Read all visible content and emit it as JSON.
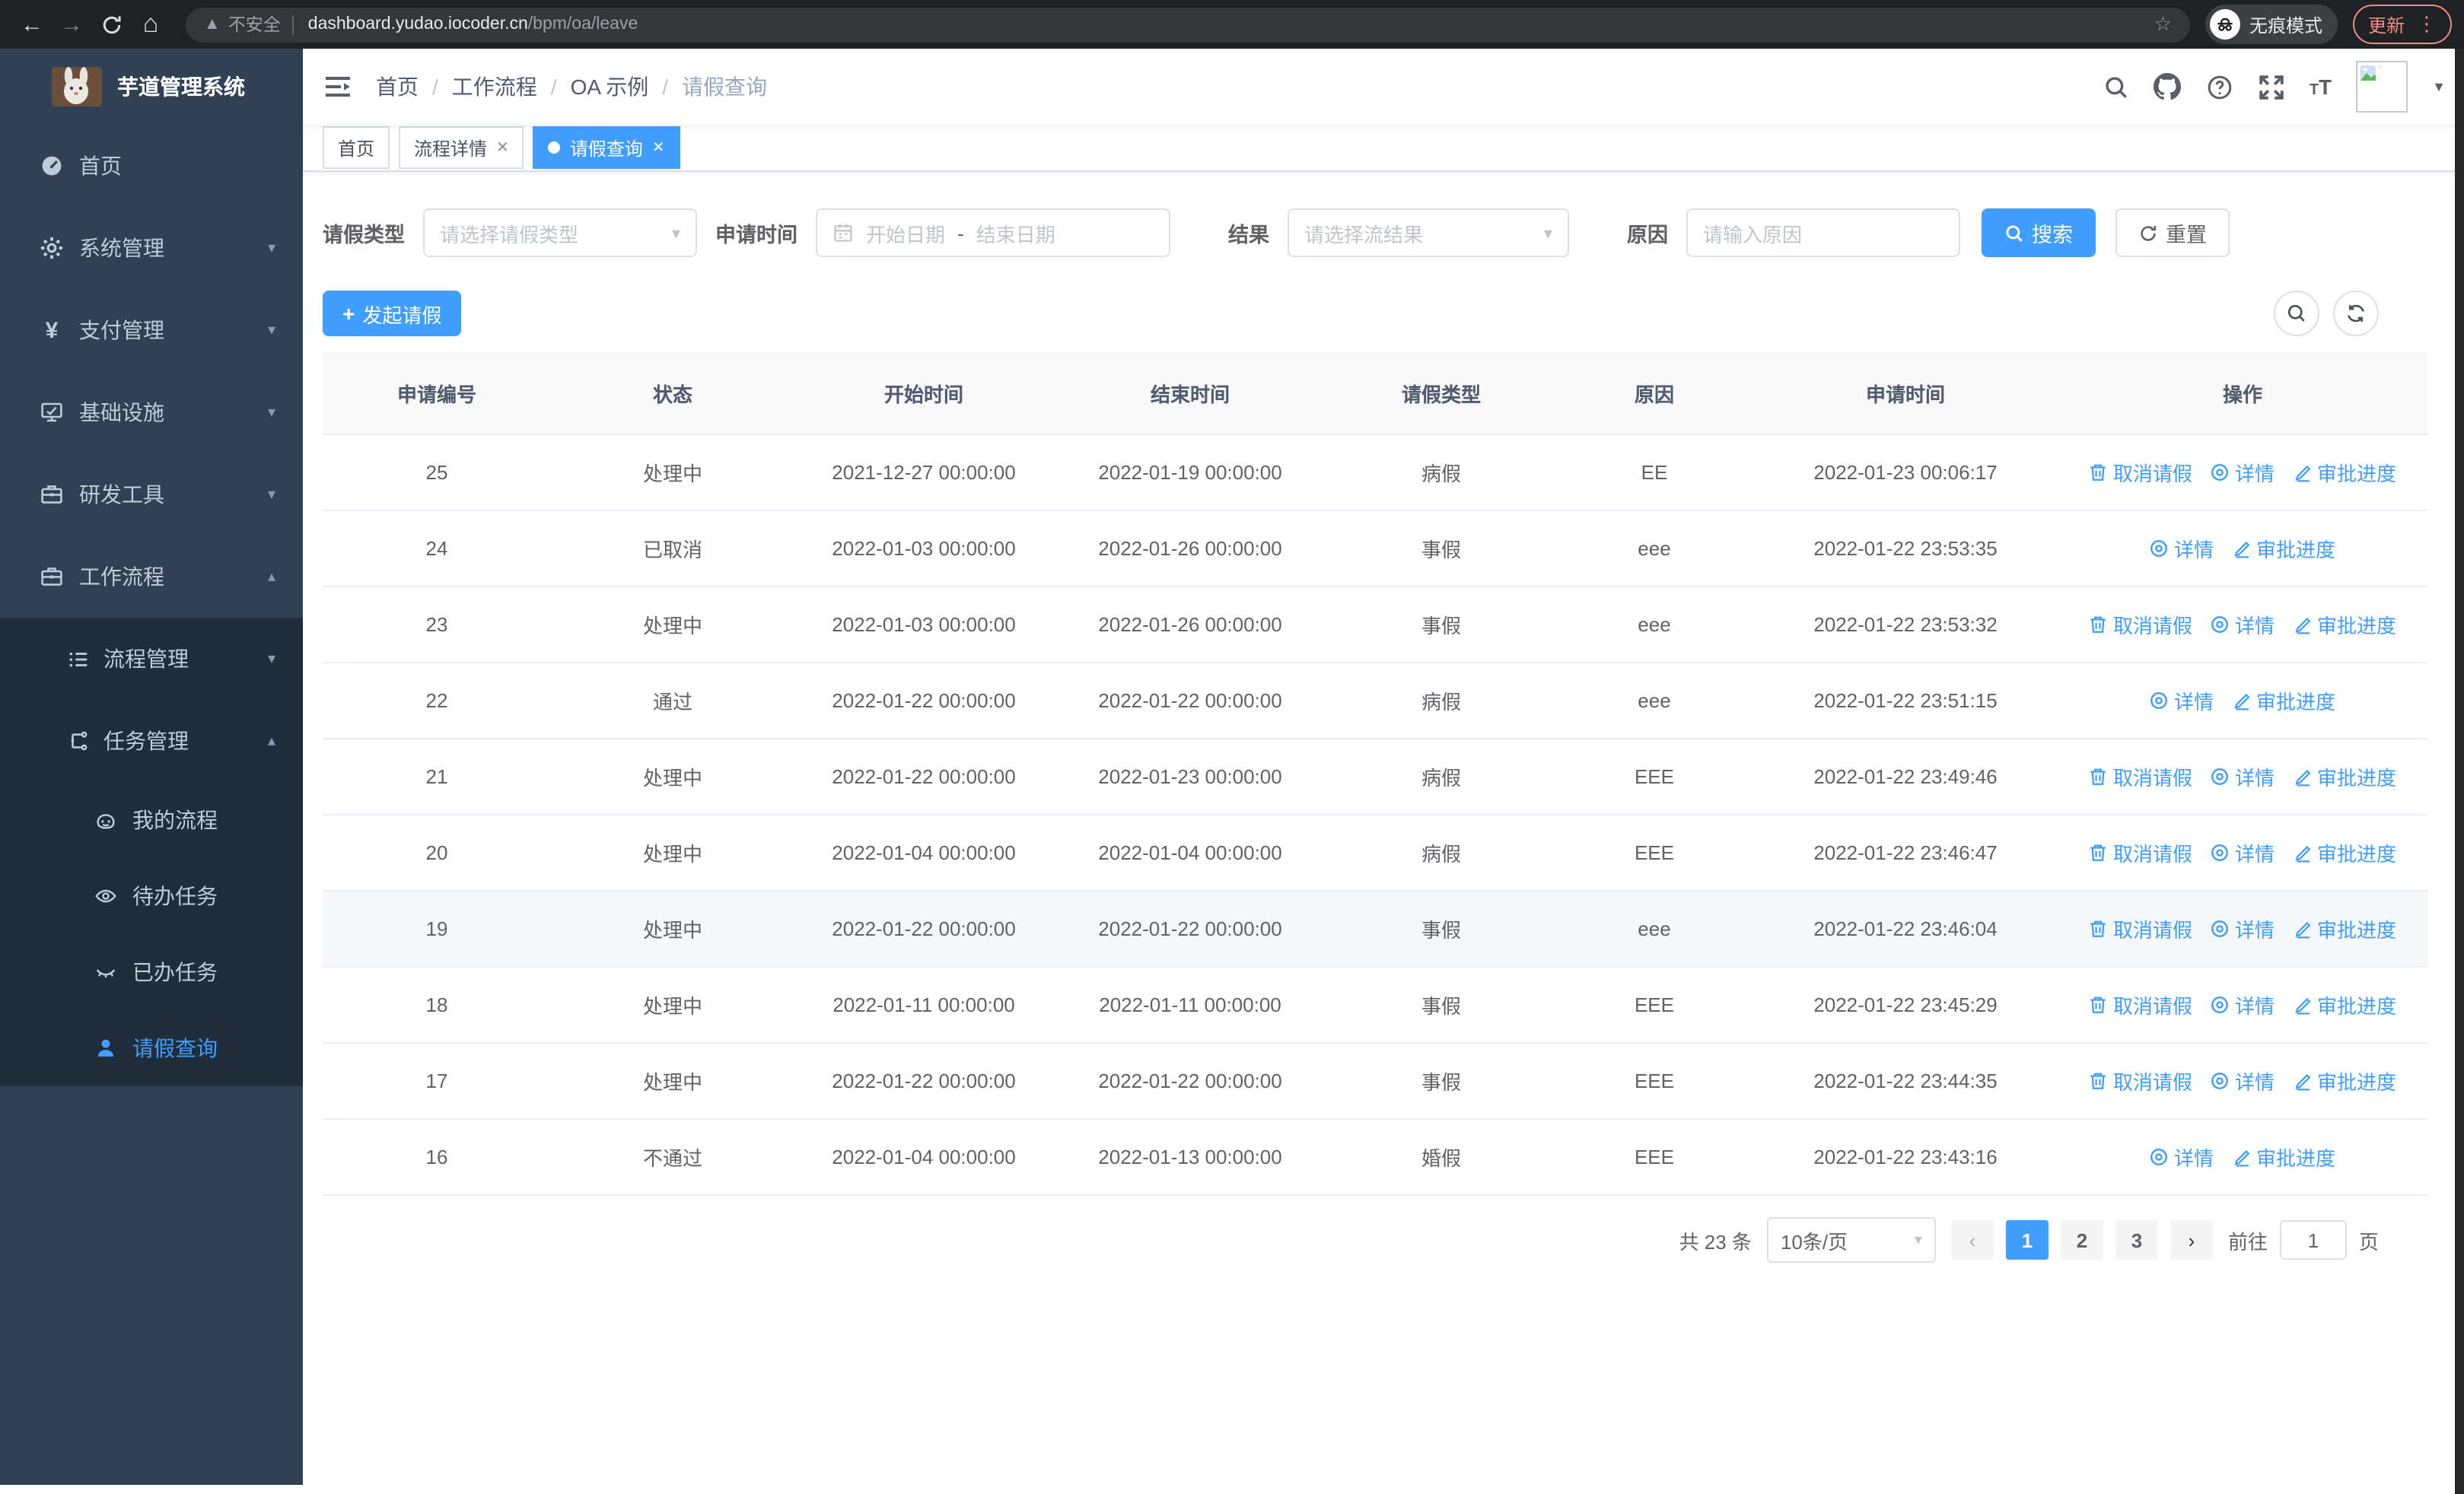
{
  "browser": {
    "security_label": "不安全",
    "url_host": "dashboard.yudao.iocoder.cn",
    "url_path": "/bpm/oa/leave",
    "incognito_label": "无痕模式",
    "update_label": "更新"
  },
  "sidebar": {
    "title": "芋道管理系统",
    "menu": [
      {
        "label": "首页",
        "icon": "dashboard-icon",
        "chevron": ""
      },
      {
        "label": "系统管理",
        "icon": "gear-icon",
        "chevron": "down"
      },
      {
        "label": "支付管理",
        "icon": "yen-icon",
        "chevron": "down"
      },
      {
        "label": "基础设施",
        "icon": "monitor-icon",
        "chevron": "down"
      },
      {
        "label": "研发工具",
        "icon": "toolbox-icon",
        "chevron": "down"
      },
      {
        "label": "工作流程",
        "icon": "workflow-icon",
        "chevron": "up"
      }
    ],
    "submenu": [
      {
        "label": "流程管理",
        "icon": "process-list-icon",
        "chevron": "down",
        "level": 2,
        "active": false
      },
      {
        "label": "任务管理",
        "icon": "task-tree-icon",
        "chevron": "up",
        "level": 2,
        "active": false
      },
      {
        "label": "我的流程",
        "icon": "robot-icon",
        "chevron": "",
        "level": 3,
        "active": false
      },
      {
        "label": "待办任务",
        "icon": "eye-icon",
        "chevron": "",
        "level": 3,
        "active": false
      },
      {
        "label": "已办任务",
        "icon": "eye-closed-icon",
        "chevron": "",
        "level": 3,
        "active": false
      },
      {
        "label": "请假查询",
        "icon": "user-icon",
        "chevron": "",
        "level": 3,
        "active": true
      }
    ]
  },
  "navbar": {
    "breadcrumb": [
      "首页",
      "工作流程",
      "OA 示例",
      "请假查询"
    ]
  },
  "tabs": [
    {
      "label": "首页",
      "closable": false,
      "active": false
    },
    {
      "label": "流程详情",
      "closable": true,
      "active": false
    },
    {
      "label": "请假查询",
      "closable": true,
      "active": true
    }
  ],
  "filters": {
    "leave_type_label": "请假类型",
    "leave_type_placeholder": "请选择请假类型",
    "apply_time_label": "申请时间",
    "start_placeholder": "开始日期",
    "range_separator": "-",
    "end_placeholder": "结束日期",
    "result_label": "结果",
    "result_placeholder": "请选择流结果",
    "reason_label": "原因",
    "reason_placeholder": "请输入原因",
    "search_label": "搜索",
    "reset_label": "重置"
  },
  "toolbar": {
    "create_label": "发起请假"
  },
  "table": {
    "headers": [
      "申请编号",
      "状态",
      "开始时间",
      "结束时间",
      "请假类型",
      "原因",
      "申请时间",
      "操作"
    ],
    "action_labels": {
      "cancel": "取消请假",
      "detail": "详情",
      "progress": "审批进度"
    },
    "rows": [
      {
        "id": "25",
        "status": "处理中",
        "start": "2021-12-27 00:00:00",
        "end": "2022-01-19 00:00:00",
        "type": "病假",
        "reason": "EE",
        "applied": "2022-01-23 00:06:17",
        "cancel": true,
        "hovered": false
      },
      {
        "id": "24",
        "status": "已取消",
        "start": "2022-01-03 00:00:00",
        "end": "2022-01-26 00:00:00",
        "type": "事假",
        "reason": "eee",
        "applied": "2022-01-22 23:53:35",
        "cancel": false,
        "hovered": false
      },
      {
        "id": "23",
        "status": "处理中",
        "start": "2022-01-03 00:00:00",
        "end": "2022-01-26 00:00:00",
        "type": "事假",
        "reason": "eee",
        "applied": "2022-01-22 23:53:32",
        "cancel": true,
        "hovered": false
      },
      {
        "id": "22",
        "status": "通过",
        "start": "2022-01-22 00:00:00",
        "end": "2022-01-22 00:00:00",
        "type": "病假",
        "reason": "eee",
        "applied": "2022-01-22 23:51:15",
        "cancel": false,
        "hovered": false
      },
      {
        "id": "21",
        "status": "处理中",
        "start": "2022-01-22 00:00:00",
        "end": "2022-01-23 00:00:00",
        "type": "病假",
        "reason": "EEE",
        "applied": "2022-01-22 23:49:46",
        "cancel": true,
        "hovered": false
      },
      {
        "id": "20",
        "status": "处理中",
        "start": "2022-01-04 00:00:00",
        "end": "2022-01-04 00:00:00",
        "type": "病假",
        "reason": "EEE",
        "applied": "2022-01-22 23:46:47",
        "cancel": true,
        "hovered": false
      },
      {
        "id": "19",
        "status": "处理中",
        "start": "2022-01-22 00:00:00",
        "end": "2022-01-22 00:00:00",
        "type": "事假",
        "reason": "eee",
        "applied": "2022-01-22 23:46:04",
        "cancel": true,
        "hovered": true
      },
      {
        "id": "18",
        "status": "处理中",
        "start": "2022-01-11 00:00:00",
        "end": "2022-01-11 00:00:00",
        "type": "事假",
        "reason": "EEE",
        "applied": "2022-01-22 23:45:29",
        "cancel": true,
        "hovered": false
      },
      {
        "id": "17",
        "status": "处理中",
        "start": "2022-01-22 00:00:00",
        "end": "2022-01-22 00:00:00",
        "type": "事假",
        "reason": "EEE",
        "applied": "2022-01-22 23:44:35",
        "cancel": true,
        "hovered": false
      },
      {
        "id": "16",
        "status": "不通过",
        "start": "2022-01-04 00:00:00",
        "end": "2022-01-13 00:00:00",
        "type": "婚假",
        "reason": "EEE",
        "applied": "2022-01-22 23:43:16",
        "cancel": false,
        "hovered": false
      }
    ]
  },
  "pagination": {
    "total_label": "共 23 条",
    "page_size_label": "10条/页",
    "pages": [
      "1",
      "2",
      "3"
    ],
    "active_page": "1",
    "goto_label": "前往",
    "goto_value": "1",
    "goto_suffix": "页"
  }
}
